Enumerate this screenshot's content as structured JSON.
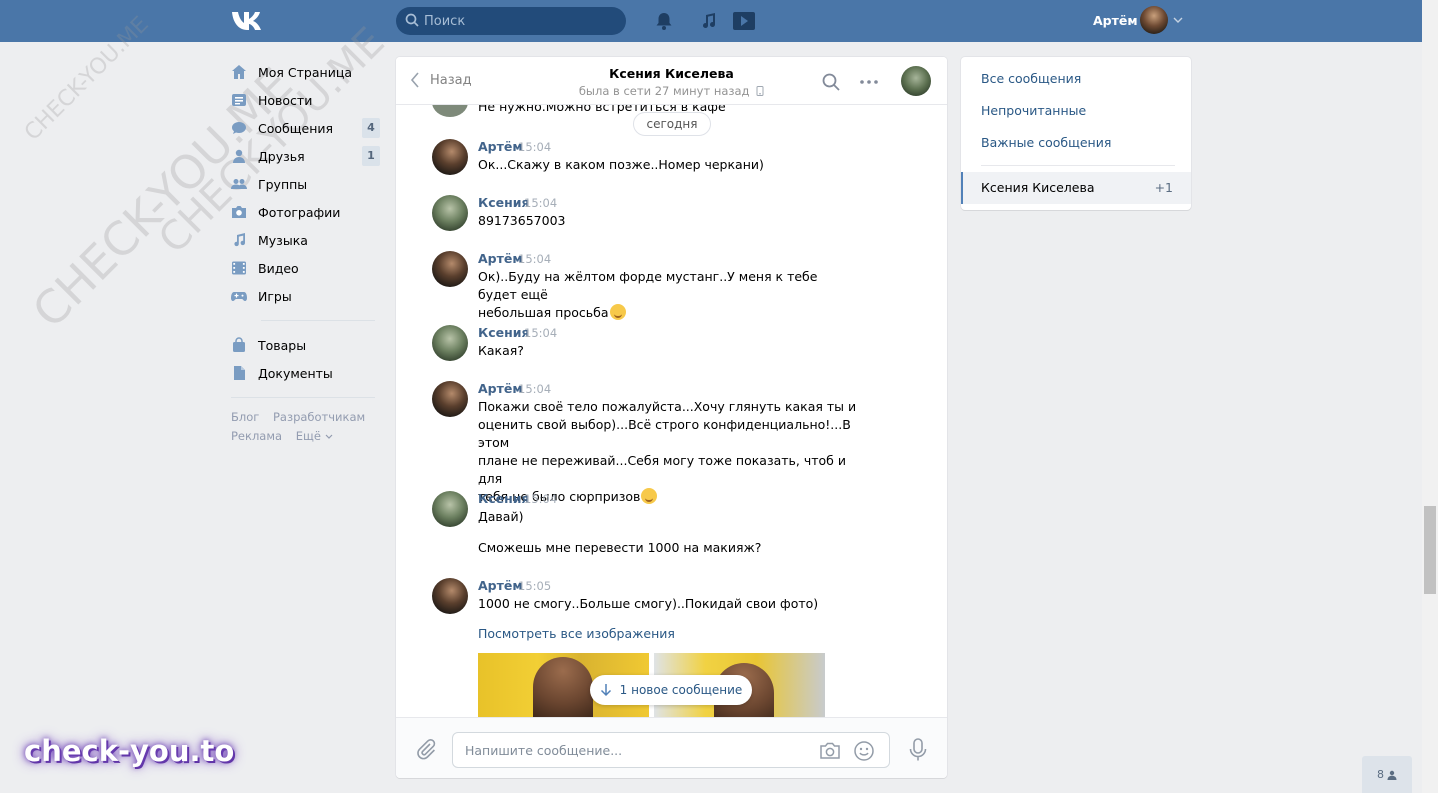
{
  "header": {
    "logo": "VK",
    "search_placeholder": "Поиск",
    "user_name": "Артём"
  },
  "leftnav": {
    "items": [
      {
        "label": "Моя Страница",
        "icon": "home-icon"
      },
      {
        "label": "Новости",
        "icon": "news-icon"
      },
      {
        "label": "Сообщения",
        "icon": "messages-icon",
        "badge": "4"
      },
      {
        "label": "Друзья",
        "icon": "friends-icon",
        "badge": "1"
      },
      {
        "label": "Группы",
        "icon": "groups-icon"
      },
      {
        "label": "Фотографии",
        "icon": "camera-icon"
      },
      {
        "label": "Музыка",
        "icon": "music-icon"
      },
      {
        "label": "Видео",
        "icon": "video-icon"
      },
      {
        "label": "Игры",
        "icon": "gamepad-icon"
      }
    ],
    "items2": [
      {
        "label": "Товары",
        "icon": "bag-icon"
      },
      {
        "label": "Документы",
        "icon": "document-icon"
      }
    ],
    "footer": {
      "blog": "Блог",
      "developers": "Разработчикам",
      "ads": "Реклама",
      "more": "Ещё"
    }
  },
  "chat": {
    "back_label": "Назад",
    "peer_name": "Ксения Киселева",
    "peer_status": "была в сети 27 минут назад",
    "cut_message": "Не нужно.Можно встретиться в кафе",
    "date_separator": "сегодня",
    "messages": [
      {
        "author": "Артём",
        "time": "15:04",
        "text": "Ок...Скажу в каком позже..Номер черкани)"
      },
      {
        "author": "Ксения",
        "time": "15:04",
        "text": "89173657003"
      },
      {
        "author": "Артём",
        "time": "15:04",
        "text_1": "Ок)..Буду на жёлтом форде мустанг..У меня к тебе будет ещё",
        "text_2": "небольшая просьба"
      },
      {
        "author": "Ксения",
        "time": "15:04",
        "text": "Какая?"
      },
      {
        "author": "Артём",
        "time": "15:04",
        "line_1": "Покажи своё тело пожалуйста...Хочу глянуть какая ты и",
        "line_2": "оценить свой выбор)...Всё строго конфиденциально!...В этом",
        "line_3": "плане не переживай...Себя могу тоже показать, чтоб и для",
        "line_4": "тебя не было сюрпризов"
      },
      {
        "author": "Ксения",
        "time": "15:04",
        "text": "Давай)",
        "text_extra": "Сможешь мне перевести 1000 на макияж?"
      },
      {
        "author": "Артём",
        "time": "15:05",
        "text": "1000 не смогу..Больше смогу)..Покидай свои фото)"
      }
    ],
    "view_all_images": "Посмотреть все изображения",
    "new_messages_pill": "1 новое сообщение",
    "composer_placeholder": "Напишите сообщение..."
  },
  "rightpanel": {
    "all": "Все сообщения",
    "unread": "Непрочитанные",
    "important": "Важные сообщения",
    "active_name": "Ксения Киселева",
    "active_count": "+1"
  },
  "watermark": {
    "brand": "check-you.to",
    "diag_1": "CHECK-YOU.ME",
    "diag_2": "CHECK-YOU.ME",
    "diag_3": "CHECK-YOU.ME"
  },
  "online_count": "8",
  "colors": {
    "header": "#4a76a8",
    "link": "#2a5885",
    "author": "#42648b",
    "background": "#edeef0"
  }
}
